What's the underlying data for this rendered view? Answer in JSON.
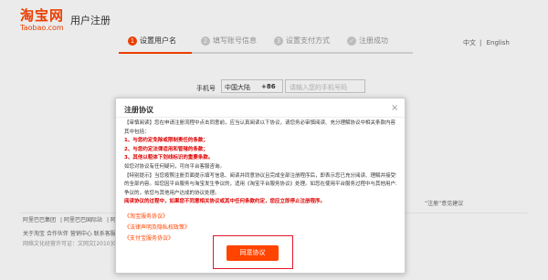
{
  "header": {
    "logo": "淘宝网",
    "logo_sub": "Taobao.com",
    "title": "用户注册"
  },
  "steps": [
    {
      "num": "1",
      "label": "设置用户名"
    },
    {
      "num": "2",
      "label": "填写账号信息"
    },
    {
      "num": "3",
      "label": "设置支付方式"
    },
    {
      "num": "✓",
      "label": "注册成功"
    }
  ],
  "lang": {
    "cn": "中文",
    "en": "English"
  },
  "form": {
    "phone_label": "手机号",
    "region": "中国大陆",
    "region_code": "+86",
    "phone_placeholder": "请输入您的手机号码"
  },
  "feedback": "“注册”意见建议",
  "footer": {
    "links": [
      "阿里巴巴集团",
      "阿里巴巴国际站",
      "阿里巴巴"
    ],
    "about": "关于淘宝  合作伙伴  营销中心  联系客服",
    "copyright": "网络文化经营许可证：文网文[2010]040号"
  },
  "modal": {
    "title": "注册协议",
    "close": "×",
    "lines": [
      "【审慎阅读】您在申请注册流程中点击同意前，应当认真阅读以下协议，请您务必审慎阅读、充分理解协议中相关条款内容，",
      "  其中包括：",
      "1、与您约定免除或限制责任的条款；",
      "2、与您约定法律适用和管辖的条款；",
      "3、其他以粗体下划线标识的重要条款。",
      "如您对协议有任何疑问，可向平台客服咨询。",
      "【特别提示】当您按照注册页面提示填写信息、阅读并同意协议且完成全部注册程序后，即表示您已充分阅读、理解并接受协议",
      "的全部内容。如您因平台服务与淘宝发生争议的，适用《淘宝平台服务协议》处理。如您在使用平台服务过程中与其他用户发生",
      "争议的，依您与其他用户达成的协议处理。",
      "阅读协议的过程中，如果您不同意相关协议或其中任何条款约定，您应立即停止注册程序。"
    ],
    "agreements": [
      "《淘宝服务协议》",
      "《法律声明及隐私权政策》",
      "《支付宝服务协议》"
    ],
    "agree_button": "同意协议"
  }
}
